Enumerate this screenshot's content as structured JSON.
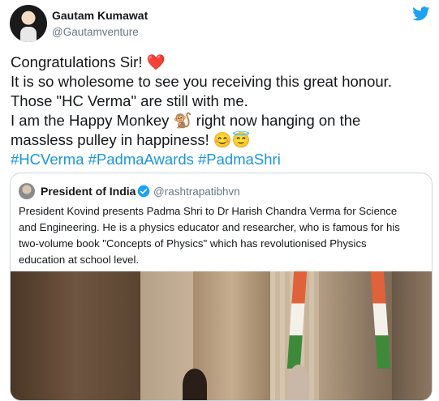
{
  "author": {
    "name": "Gautam Kumawat",
    "handle": "@Gautamventure"
  },
  "tweet": {
    "lines": [
      "Congratulations Sir! ❤️",
      "It is so wholesome to see you receiving this great honour.",
      "Those \"HC Verma\" are still with me.",
      "I am the Happy Monkey 🐒 right now hanging on the",
      "massless pulley in happiness! 😊😇"
    ],
    "hashtags": "#HCVerma #PadmaAwards #PadmaShri"
  },
  "quoted": {
    "name": "President of India",
    "handle": "@rashtrapatibhvn",
    "lines": [
      "President Kovind presents Padma Shri to  Dr Harish Chandra Verma for Science",
      "and Engineering. He is a physics educator and researcher, who is famous for his",
      "two-volume book \"Concepts of Physics\" which has revolutionised Physics",
      "education at school level."
    ]
  },
  "icons": {
    "brand": "twitter-bird-icon",
    "verified": "verified-badge-icon"
  },
  "colors": {
    "link": "#1b95e0",
    "twitter_blue": "#1da1f2",
    "secondary_text": "#657786"
  }
}
